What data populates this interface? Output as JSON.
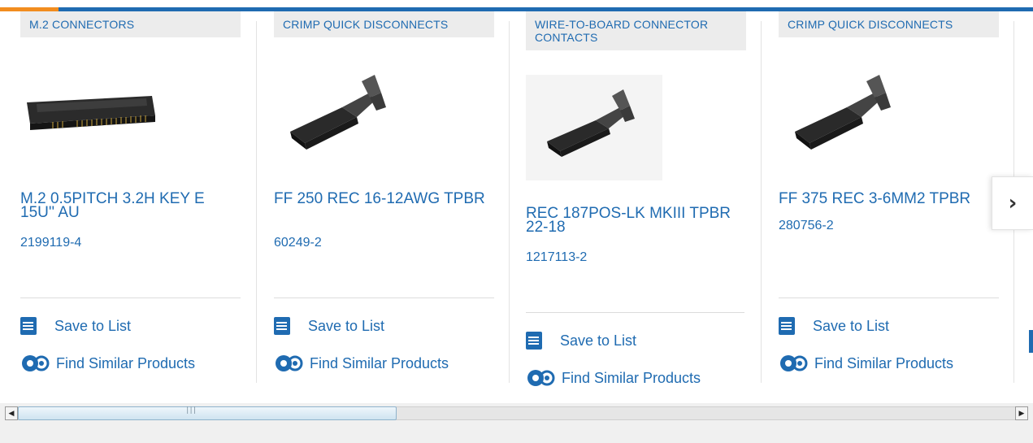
{
  "colors": {
    "accent": "#1f6bb1",
    "brand_orange": "#f28d1f",
    "tag_bg": "#ececec"
  },
  "cards": [
    {
      "category": "M.2 CONNECTORS",
      "name": "M.2 0.5PITCH 3.2H KEY E 15U'' AU",
      "part": "2199119-4",
      "save": "Save to List",
      "similar": "Find Similar Products",
      "image": "m2-connector-image"
    },
    {
      "category": "CRIMP QUICK DISCONNECTS",
      "name": "FF 250 REC 16-12AWG TPBR",
      "part": "60249-2",
      "save": "Save to List",
      "similar": "Find Similar Products",
      "image": "crimp-terminal-image"
    },
    {
      "category": "WIRE-TO-BOARD CONNECTOR CONTACTS",
      "name": "REC 187POS-LK MKIII TPBR 22-18",
      "part": "1217113-2",
      "save": "Save to List",
      "similar": "Find Similar Products",
      "image": "crimp-terminal-image"
    },
    {
      "category": "CRIMP QUICK DISCONNECTS",
      "name": "FF 375 REC 3-6MM2 TPBR",
      "part": "280756-2",
      "save": "Save to List",
      "similar": "Find Similar Products",
      "image": "crimp-terminal-image"
    }
  ],
  "next_icon": "chevron-right-icon",
  "next_glyph": "›"
}
